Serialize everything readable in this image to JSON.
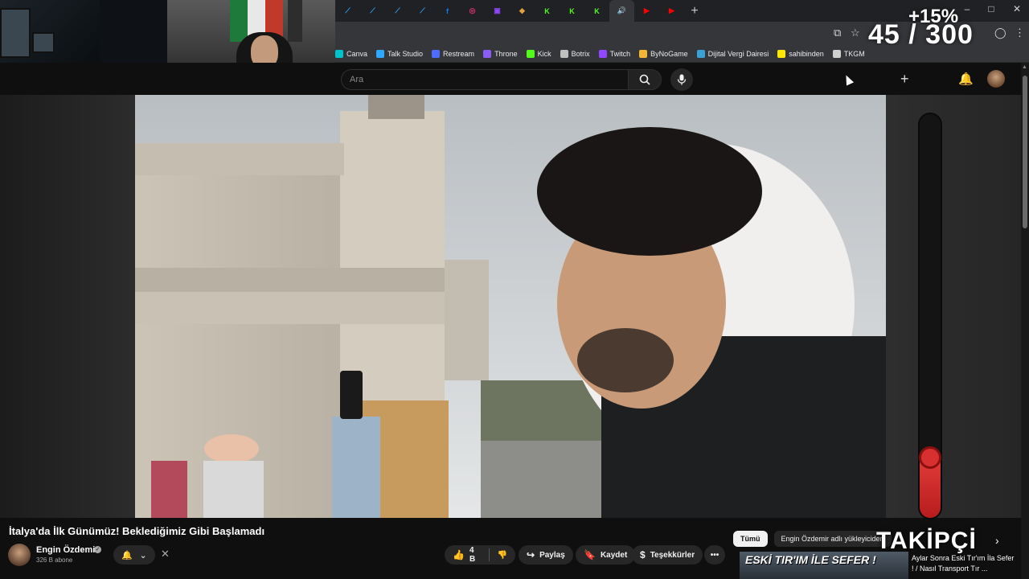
{
  "browser": {
    "tabs": [
      {
        "icon": "restream-icon",
        "color": "#2ea8ff",
        "glyph": "⟋"
      },
      {
        "icon": "restream-icon",
        "color": "#2ea8ff",
        "glyph": "⟋"
      },
      {
        "icon": "restream-icon",
        "color": "#2ea8ff",
        "glyph": "⟋"
      },
      {
        "icon": "restream-icon",
        "color": "#2ea8ff",
        "glyph": "⟋"
      },
      {
        "icon": "facebook-icon",
        "color": "#1877f2",
        "glyph": "f"
      },
      {
        "icon": "instagram-icon",
        "color": "#e1306c",
        "glyph": "◎"
      },
      {
        "icon": "twitch-icon",
        "color": "#9146ff",
        "glyph": "▣"
      },
      {
        "icon": "botrix-icon",
        "color": "#e0a33c",
        "glyph": "◆"
      },
      {
        "icon": "kick-icon",
        "color": "#53fc18",
        "glyph": "K"
      },
      {
        "icon": "kick-icon",
        "color": "#53fc18",
        "glyph": "K"
      },
      {
        "icon": "kick-icon",
        "color": "#53fc18",
        "glyph": "K"
      },
      {
        "icon": "speaker-icon",
        "color": "#cfcfcf",
        "glyph": "🔊",
        "active": true
      },
      {
        "icon": "youtube-icon",
        "color": "#ff0000",
        "glyph": "▶"
      },
      {
        "icon": "youtube-icon",
        "color": "#ff0000",
        "glyph": "▶"
      }
    ],
    "new_tab_label": "+",
    "window_controls": {
      "minimize": "–",
      "maximize": "□",
      "close": "✕"
    },
    "bookmarks": [
      {
        "label": "Canva",
        "icon": "canva-icon",
        "color": "#00c4cc"
      },
      {
        "label": "Talk Studio",
        "icon": "talk-studio-icon",
        "color": "#2ea8ff"
      },
      {
        "label": "Restream",
        "icon": "restream-icon",
        "color": "#4f6bff"
      },
      {
        "label": "Throne",
        "icon": "throne-icon",
        "color": "#8a5cf6"
      },
      {
        "label": "Kick",
        "icon": "kick-icon",
        "color": "#53fc18"
      },
      {
        "label": "Botrix",
        "icon": "botrix-icon",
        "color": "#c0c0c0"
      },
      {
        "label": "Twitch",
        "icon": "twitch-icon",
        "color": "#9146ff"
      },
      {
        "label": "ByNoGame",
        "icon": "bynogame-icon",
        "color": "#f2b632"
      },
      {
        "label": "Dijital Vergi Dairesi",
        "icon": "vergi-icon",
        "color": "#3aa0d8"
      },
      {
        "label": "sahibinden",
        "icon": "sahibinden-icon",
        "color": "#ffe800"
      },
      {
        "label": "TKGM",
        "icon": "location-icon",
        "color": "#cfcfcf"
      }
    ]
  },
  "overlay": {
    "counter": "45 / 300",
    "percent": "+15%",
    "takipci": "TAKİPÇİ",
    "thermometer_level": 0.15
  },
  "youtube": {
    "search_placeholder": "Ara",
    "video_title": "İtalya'da İlk Günümüz! Beklediğimiz Gibi Başlamadı",
    "channel_name": "Engin Özdemir",
    "subscribers": "326 B abone",
    "likes": "4 B",
    "share_label": "Paylaş",
    "save_label": "Kaydet",
    "thanks_label": "Teşekkürler",
    "more_label": "•••",
    "chips": [
      {
        "label": "Tümü",
        "active": true
      },
      {
        "label": "Engin Özdemir adlı yükleyiciden",
        "active": false
      }
    ],
    "recommended": {
      "thumb_text": "ESKİ TIR'IM İLE SEFER !",
      "title": "Aylar Sonra Eski Tır'ım İla Sefer ! / Nasıl Transport Tır ..."
    }
  },
  "colors": {
    "background": "#0f0f0f",
    "youtube_red": "#ff0000",
    "thermometer_red": "#d83030"
  }
}
